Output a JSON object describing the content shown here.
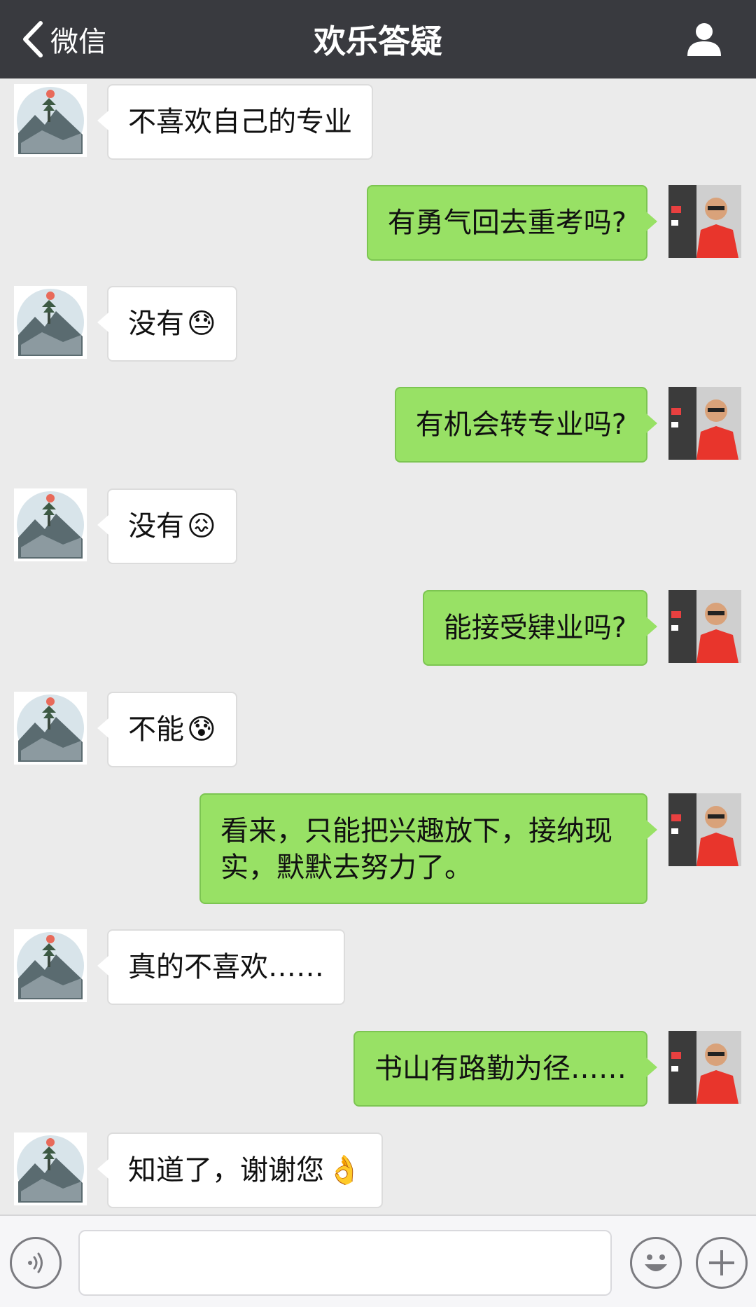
{
  "header": {
    "back_label": "微信",
    "title": "欢乐答疑",
    "profile_icon": "person-icon",
    "bg_color": "#393a3f"
  },
  "messages": [
    {
      "side": "left",
      "text": "不喜欢自己的专业",
      "emoji": ""
    },
    {
      "side": "right",
      "text": "有勇气回去重考吗?",
      "emoji": ""
    },
    {
      "side": "left",
      "text": "没有",
      "emoji": "😓"
    },
    {
      "side": "right",
      "text": "有机会转专业吗?",
      "emoji": ""
    },
    {
      "side": "left",
      "text": "没有",
      "emoji": "😖"
    },
    {
      "side": "right",
      "text": "能接受肄业吗?",
      "emoji": ""
    },
    {
      "side": "left",
      "text": "不能",
      "emoji": "😰"
    },
    {
      "side": "right",
      "text": "看来，只能把兴趣放下，接纳现实，默默去努力了。",
      "emoji": ""
    },
    {
      "side": "left",
      "text": "真的不喜欢……",
      "emoji": ""
    },
    {
      "side": "right",
      "text": "书山有路勤为径……",
      "emoji": ""
    },
    {
      "side": "left",
      "text": "知道了，谢谢您",
      "emoji": "👌"
    }
  ],
  "input_bar": {
    "voice_icon": "voice-icon",
    "emoji_icon": "smiley-icon",
    "plus_icon": "plus-icon"
  },
  "colors": {
    "background": "#ebebeb",
    "sent_bubble": "#98e165",
    "received_bubble": "#ffffff"
  }
}
